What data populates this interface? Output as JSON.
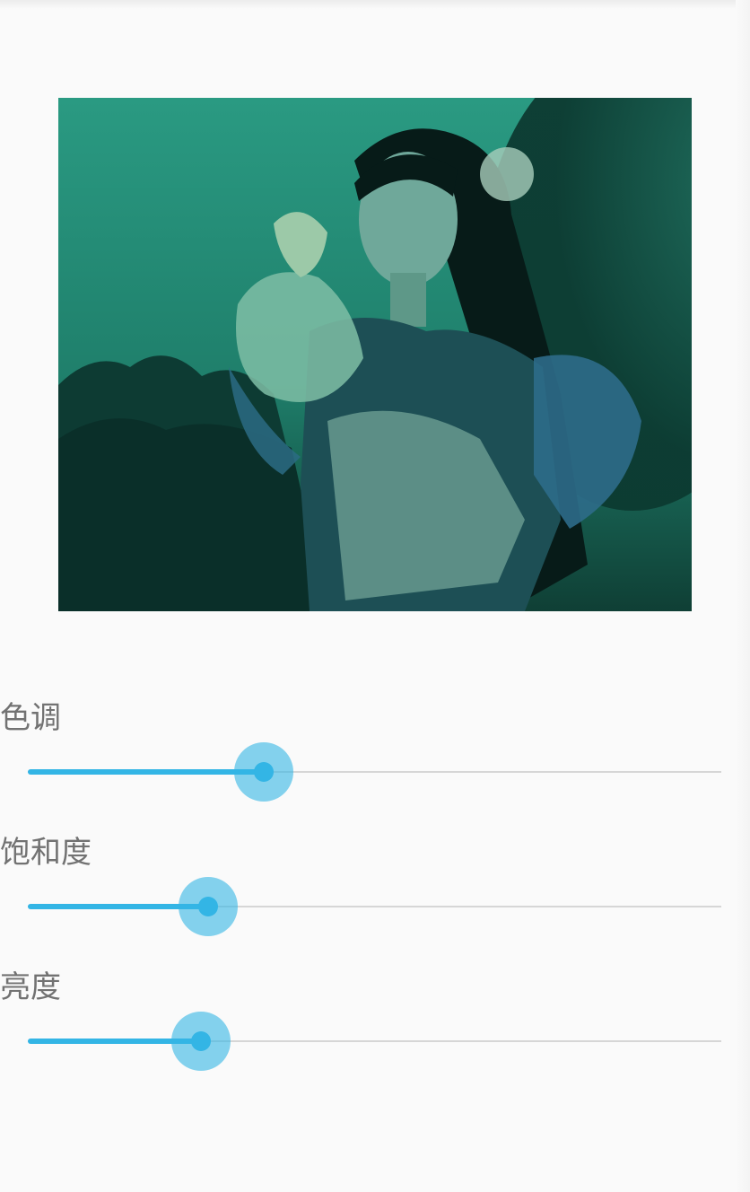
{
  "image": {
    "description_icon": "photo-image"
  },
  "sliders": [
    {
      "label": "色调",
      "value": 0.34
    },
    {
      "label": "饱和度",
      "value": 0.26
    },
    {
      "label": "亮度",
      "value": 0.25
    }
  ],
  "colors": {
    "accent": "#33b5e5",
    "track": "#d6d6d6",
    "label": "#727272",
    "background": "#fafafa"
  }
}
